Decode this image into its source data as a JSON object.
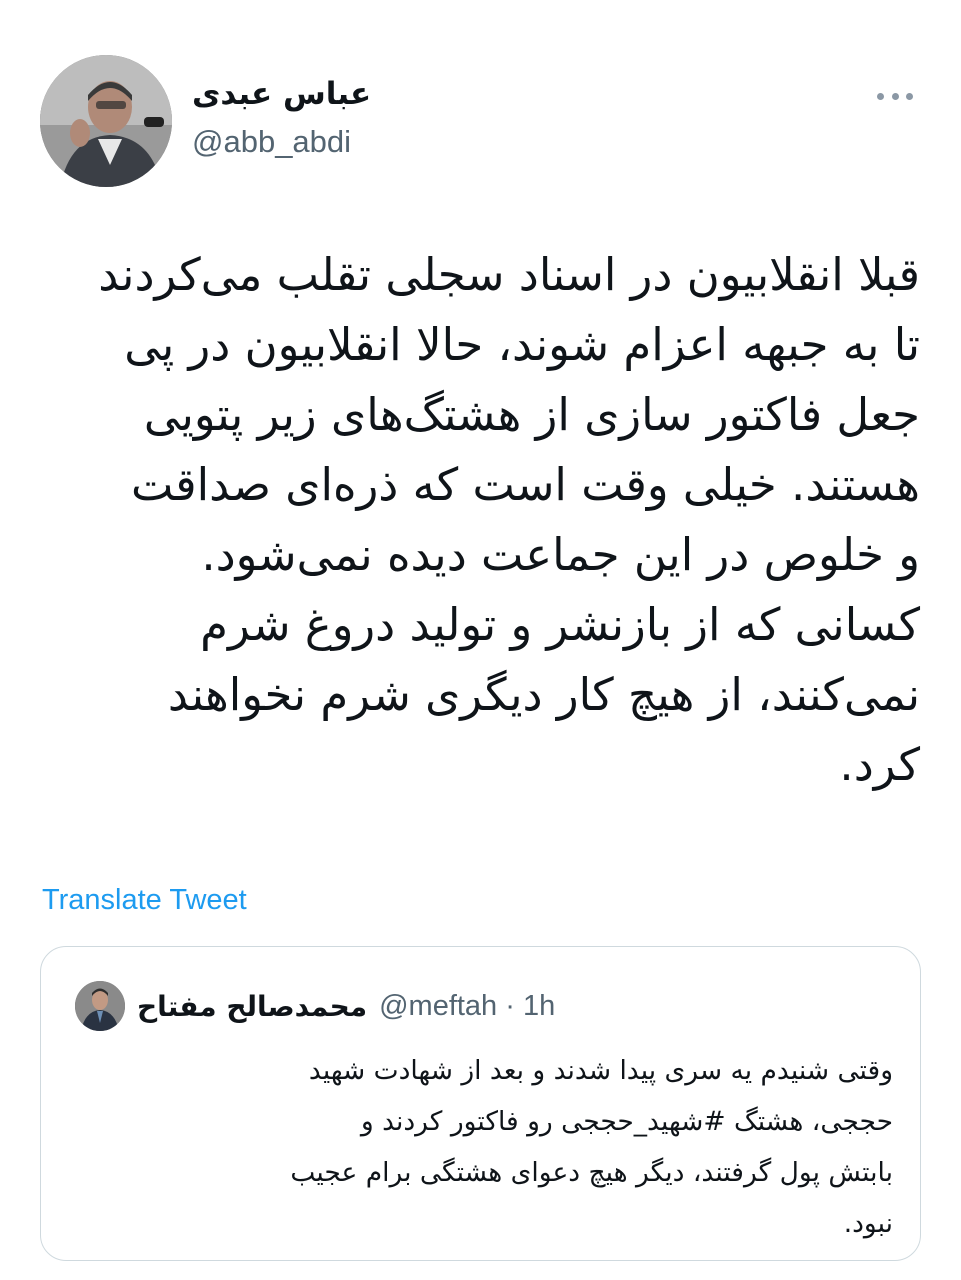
{
  "tweet": {
    "author_name": "عباس عبدی",
    "author_handle": "@abb_abdi",
    "text_lines": [
      "قبلا انقلابیون در اسناد سجلی تقلب می‌کردند",
      "تا به جبهه اعزام شوند، حالا انقلابیون در پی",
      "جعل فاکتور سازی از هشتگ‌های زیر پتویی",
      "هستند. خیلی وقت است که ذره‌ای صداقت",
      "و خلوص در این جماعت دیده نمی‌شود.",
      "کسانی که از بازنشر و تولید دروغ شرم",
      "نمی‌کنند، از هیچ کار دیگری شرم نخواهند",
      "کرد."
    ],
    "translate_label": "Translate Tweet",
    "more_icon": "ellipsis-icon"
  },
  "quoted_tweet": {
    "author_name": "محمدصالح مفتاح",
    "meta": "@meftah · 1h",
    "text_lines": [
      "وقتی شنیدم یه سری پیدا شدند و بعد از شهادت شهید",
      "حججی، هشتگ #شهید_حججی رو فاکتور کردند و",
      "بابتش پول گرفتند، دیگر هیچ دعوای هشتگی برام عجیب",
      "نبود."
    ]
  },
  "colors": {
    "link": "#1d9bf0",
    "secondary_text": "#536471",
    "border": "#cfd9de"
  }
}
